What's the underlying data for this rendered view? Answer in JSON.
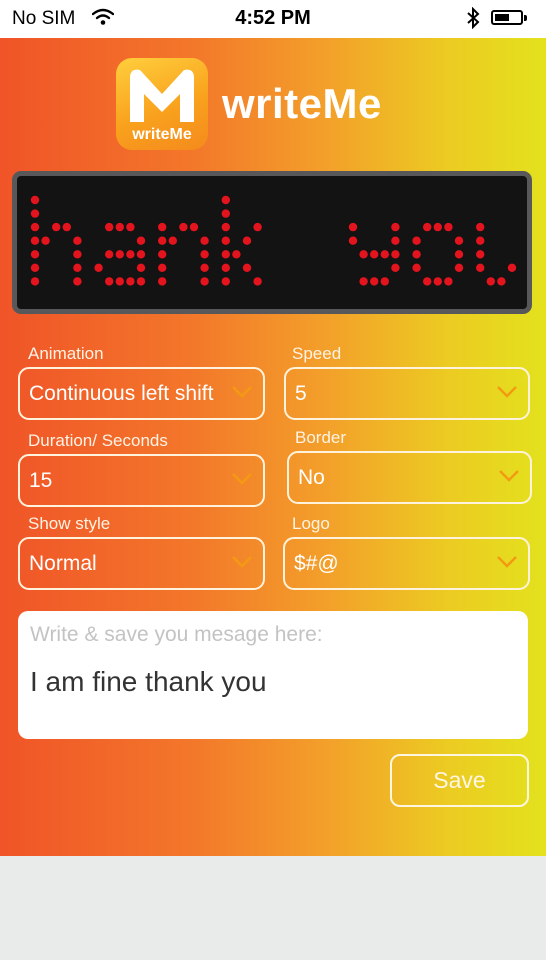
{
  "status_bar": {
    "carrier": "No SIM",
    "time": "4:52 PM",
    "battery_level": 0.6,
    "icons": [
      "wifi-icon",
      "bluetooth-icon",
      "battery-icon"
    ]
  },
  "brand": {
    "name": "writeMe",
    "badge_text": "writeMe",
    "badge_letter": "M"
  },
  "led_display": {
    "text": "hank you",
    "dot_color": "#e4141e",
    "background": "#131313"
  },
  "form": {
    "animation": {
      "label": "Animation",
      "value": "Continuous left shift"
    },
    "speed": {
      "label": "Speed",
      "value": "5"
    },
    "duration": {
      "label": "Duration/ Seconds",
      "value": "15"
    },
    "border": {
      "label": "Border",
      "value": "No"
    },
    "show_style": {
      "label": "Show style",
      "value": "Normal"
    },
    "logo": {
      "label": "Logo",
      "value": "$#@"
    }
  },
  "message": {
    "placeholder": "Write & save you mesage here:",
    "value": "I am fine thank you"
  },
  "save_label": "Save",
  "colors": {
    "gradient_left": "#f05428",
    "gradient_right": "#e3e21d",
    "chevron": "#f39a12",
    "placeholder": "#c3c3c3"
  }
}
